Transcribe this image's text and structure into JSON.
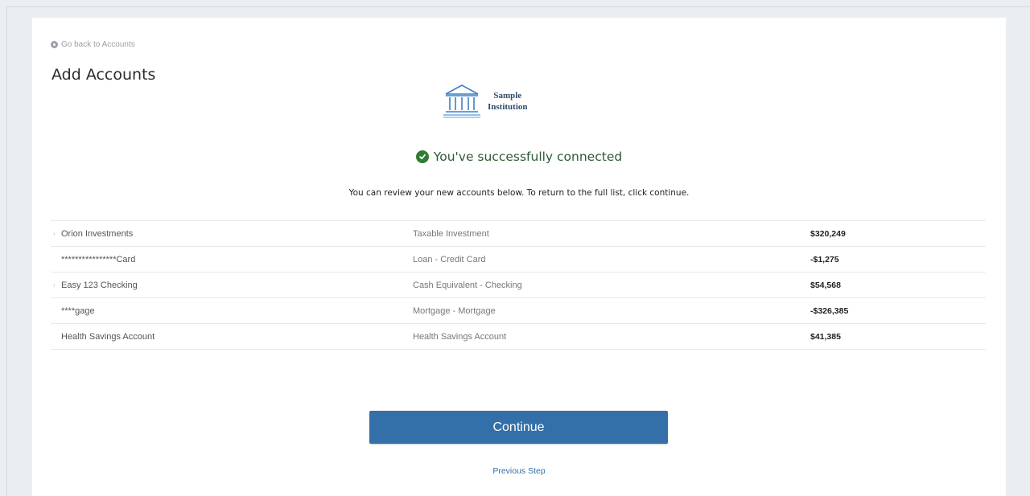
{
  "nav": {
    "back_label": "Go back to Accounts"
  },
  "page": {
    "title": "Add Accounts",
    "institution_line1": "Sample",
    "institution_line2": "Institution",
    "success_message": "You've successfully connected",
    "subtitle": "You can review your new accounts below. To return to the full list, click continue."
  },
  "accounts": [
    {
      "name": "Orion Investments",
      "type": "Taxable Investment",
      "amount": "$320,249",
      "has_caret": true
    },
    {
      "name": "****************Card",
      "type": "Loan - Credit Card",
      "amount": "-$1,275",
      "has_caret": false
    },
    {
      "name": "Easy 123 Checking",
      "type": "Cash Equivalent - Checking",
      "amount": "$54,568",
      "has_caret": true
    },
    {
      "name": "****gage",
      "type": "Mortgage - Mortgage",
      "amount": "-$326,385",
      "has_caret": false
    },
    {
      "name": "Health Savings Account",
      "type": "Health Savings Account",
      "amount": "$41,385",
      "has_caret": false
    }
  ],
  "actions": {
    "continue_label": "Continue",
    "previous_label": "Previous Step"
  },
  "colors": {
    "primary": "#336fa8",
    "success": "#2e7d32",
    "background": "#e9eef2"
  },
  "icons": {
    "back": "circle-icon",
    "logo": "bank-building-icon",
    "success": "check-circle-icon"
  }
}
